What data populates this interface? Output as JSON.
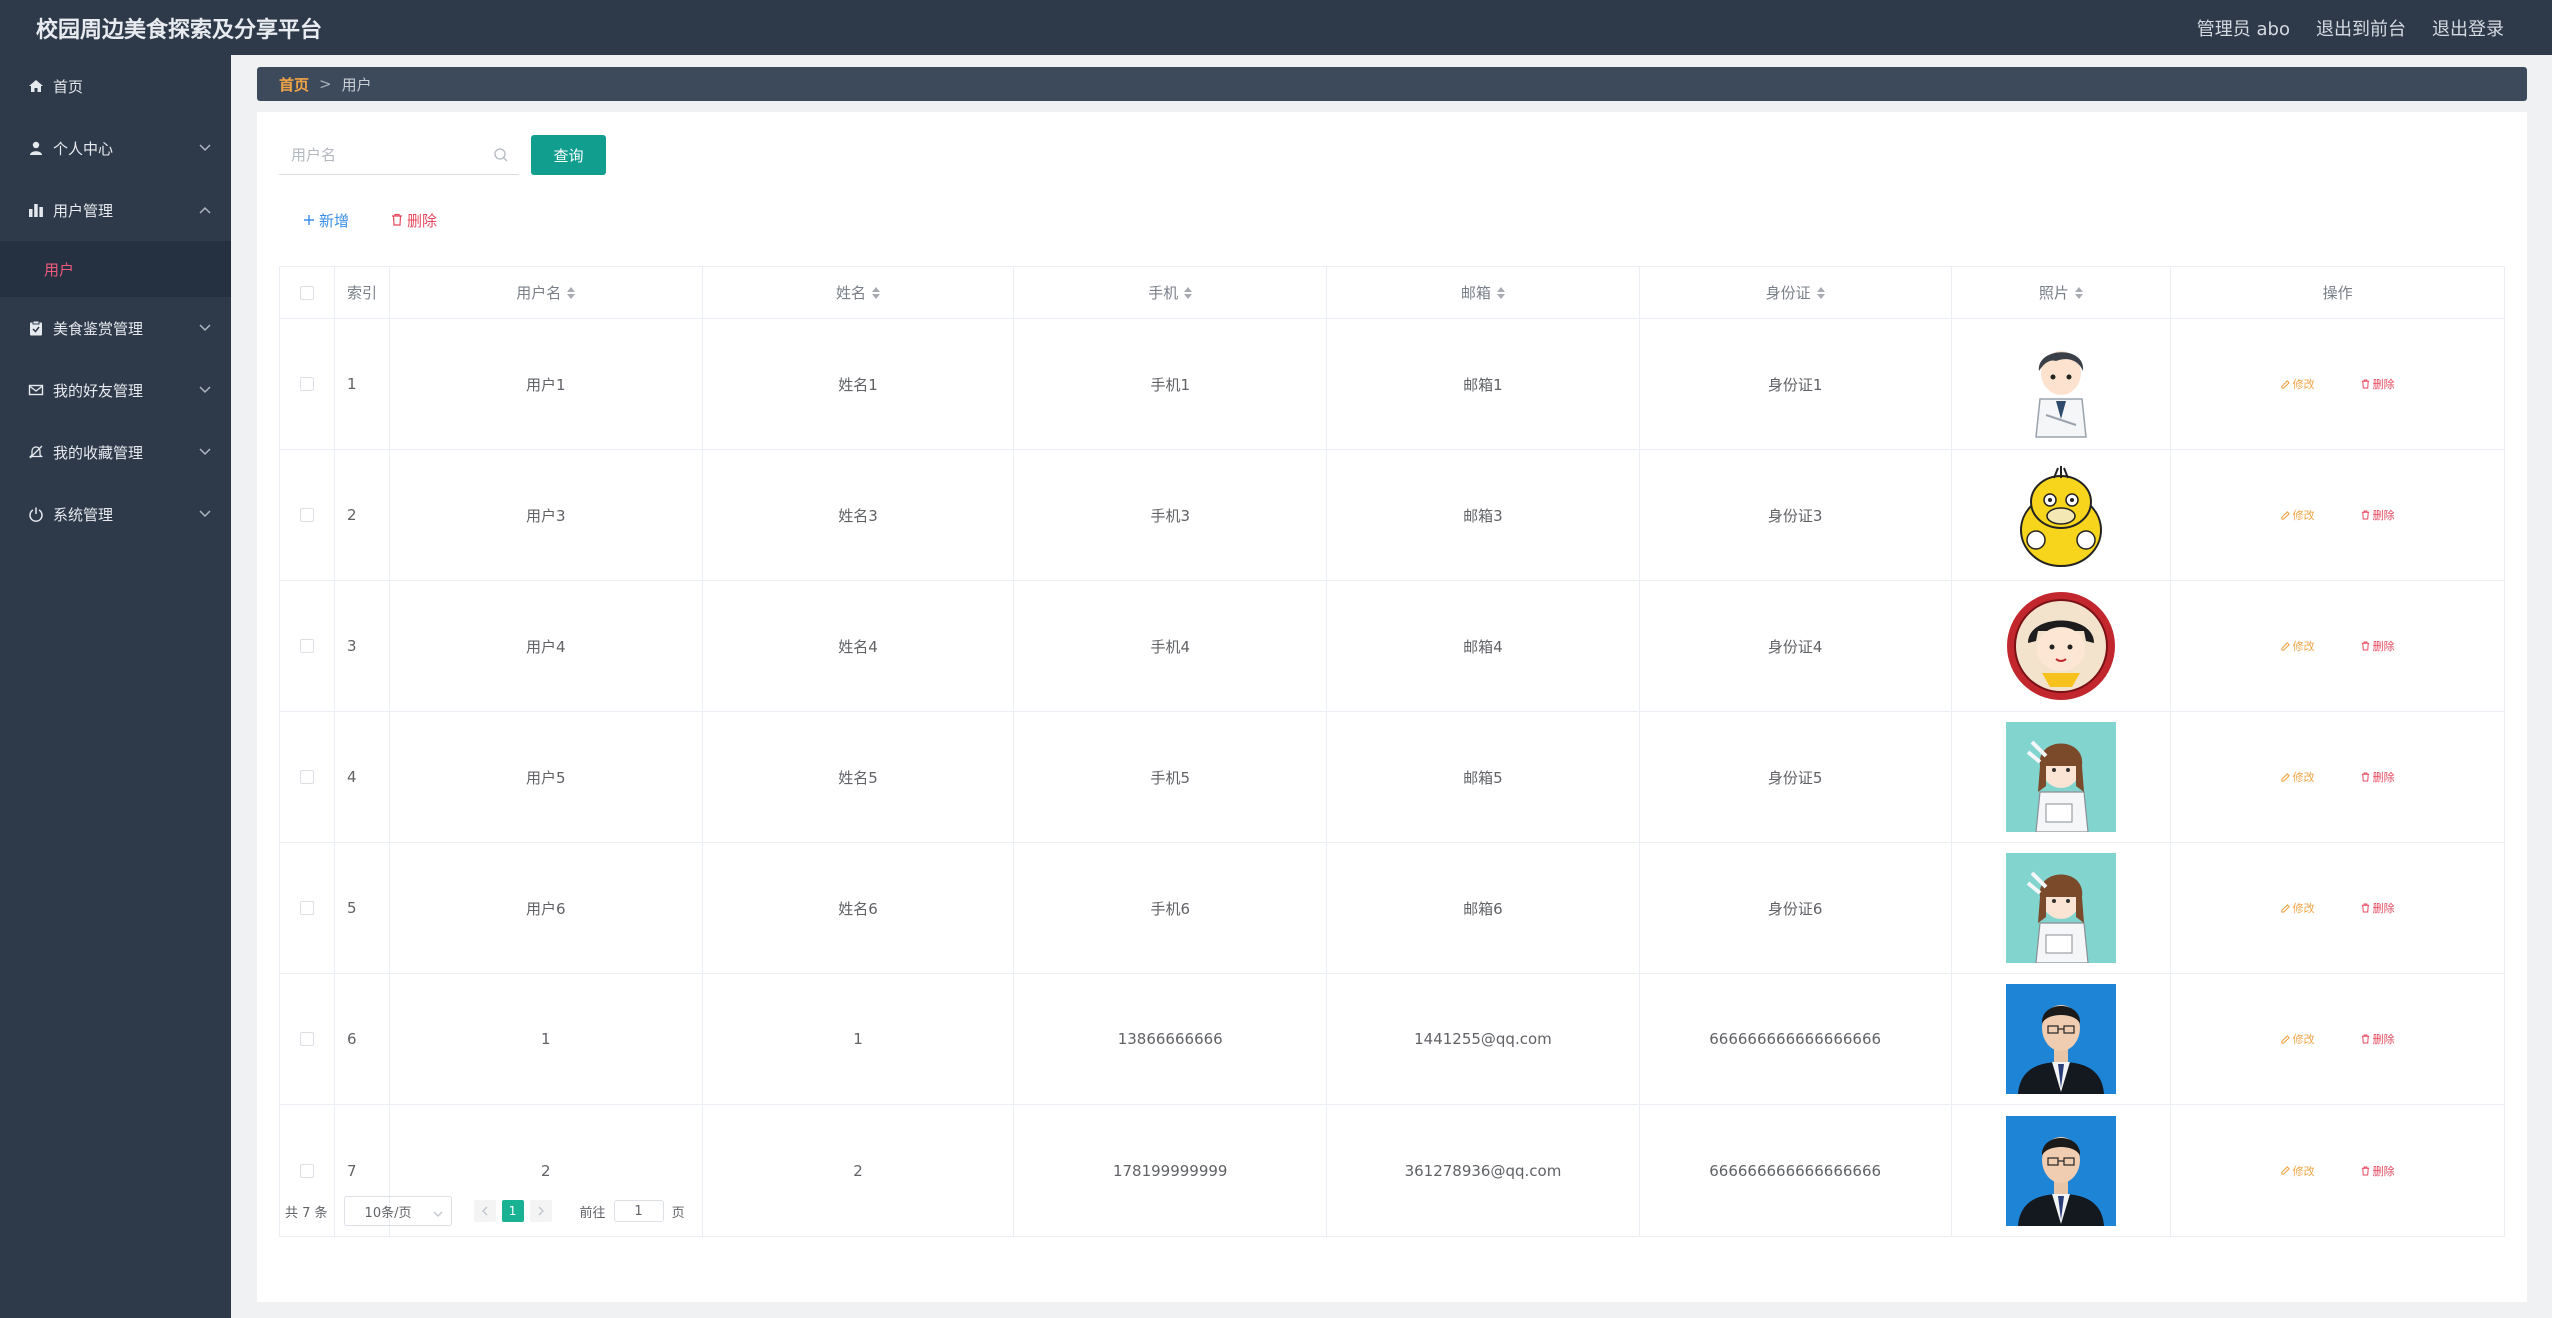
{
  "header": {
    "title": "校园周边美食探索及分享平台",
    "admin_label": "管理员 abo",
    "to_front": "退出到前台",
    "logout": "退出登录"
  },
  "sidebar": {
    "items": [
      {
        "label": "首页",
        "icon": "home-icon"
      },
      {
        "label": "个人中心",
        "icon": "user-icon"
      },
      {
        "label": "用户管理",
        "icon": "chart-icon"
      },
      {
        "label": "用户",
        "icon": ""
      },
      {
        "label": "美食鉴赏管理",
        "icon": "clipboard-icon"
      },
      {
        "label": "我的好友管理",
        "icon": "mail-icon"
      },
      {
        "label": "我的收藏管理",
        "icon": "bell-off-icon"
      },
      {
        "label": "系统管理",
        "icon": "power-icon"
      }
    ]
  },
  "breadcrumb": {
    "home": "首页",
    "separator": ">",
    "current": "用户"
  },
  "search": {
    "placeholder": "用户名",
    "value": "",
    "button": "查询"
  },
  "actions": {
    "add": "新增",
    "delete": "删除"
  },
  "table": {
    "headers": {
      "index": "索引",
      "username": "用户名",
      "name": "姓名",
      "phone": "手机",
      "email": "邮箱",
      "idcard": "身份证",
      "photo": "照片",
      "op": "操作"
    },
    "rows": [
      {
        "index": "1",
        "username": "用户1",
        "name": "姓名1",
        "phone": "手机1",
        "email": "邮箱1",
        "idcard": "身份证1",
        "photo": "cartoon-boy-avatar"
      },
      {
        "index": "2",
        "username": "用户3",
        "name": "姓名3",
        "phone": "手机3",
        "email": "邮箱3",
        "idcard": "身份证3",
        "photo": "yellow-duck-avatar"
      },
      {
        "index": "3",
        "username": "用户4",
        "name": "姓名4",
        "phone": "手机4",
        "email": "邮箱4",
        "idcard": "身份证4",
        "photo": "cartoon-girl-badge-avatar"
      },
      {
        "index": "4",
        "username": "用户5",
        "name": "姓名5",
        "phone": "手机5",
        "email": "邮箱5",
        "idcard": "身份证5",
        "photo": "anime-girl-avatar"
      },
      {
        "index": "5",
        "username": "用户6",
        "name": "姓名6",
        "phone": "手机6",
        "email": "邮箱6",
        "idcard": "身份证6",
        "photo": "anime-girl-avatar"
      },
      {
        "index": "6",
        "username": "1",
        "name": "1",
        "phone": "13866666666",
        "email": "1441255@qq.com",
        "idcard": "666666666666666666",
        "photo": "id-photo-man"
      },
      {
        "index": "7",
        "username": "2",
        "name": "2",
        "phone": "178199999999",
        "email": "361278936@qq.com",
        "idcard": "666666666666666666",
        "photo": "id-photo-man"
      }
    ],
    "op_edit": "修改",
    "op_delete": "删除"
  },
  "pagination": {
    "total": "共 7 条",
    "page_size": "10条/页",
    "current_page": "1",
    "goto_prefix": "前往",
    "goto_value": "1",
    "goto_suffix": "页"
  },
  "colors": {
    "header_bg": "#2e3a4a",
    "accent_teal": "#119e8f",
    "active_page": "#19b394",
    "edit_orange": "#f0a446",
    "delete_red": "#e5485d",
    "submenu_active": "#f05a7c"
  }
}
